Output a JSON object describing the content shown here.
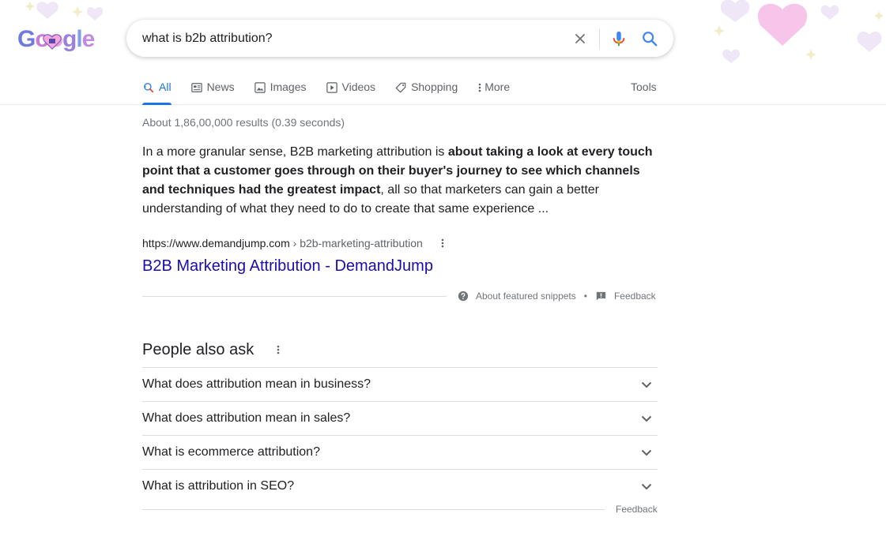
{
  "logo": {
    "text": "Google"
  },
  "search": {
    "query": "what is b2b attribution?"
  },
  "icons": {
    "clear": "close-icon",
    "voice": "microphone-icon",
    "search": "search-icon"
  },
  "tabs": [
    {
      "label": "All",
      "icon": "search-icon",
      "active": true
    },
    {
      "label": "News",
      "icon": "newspaper-icon"
    },
    {
      "label": "Images",
      "icon": "image-icon"
    },
    {
      "label": "Videos",
      "icon": "play-icon"
    },
    {
      "label": "Shopping",
      "icon": "tag-icon"
    },
    {
      "label": "More",
      "icon": "kebab-icon"
    }
  ],
  "tools_label": "Tools",
  "stats": "About 1,86,00,000 results (0.39 seconds)",
  "featured": {
    "text_pre": "In a more granular sense, B2B marketing attribution is ",
    "text_bold": "about taking a look at every touch point that a customer goes through on their buyer's journey to see which channels and techniques had the greatest impact",
    "text_post": ", all so that marketers can gain a better understanding of what they need to do to create that same experience ...",
    "cite_domain": "https://www.demandjump.com",
    "cite_path": " › b2b-marketing-attribution",
    "title": "B2B Marketing Attribution - DemandJump",
    "about_label": "About featured snippets",
    "separator": "•",
    "feedback_label": "Feedback"
  },
  "paa": {
    "title": "People also ask",
    "questions": [
      "What does attribution mean in business?",
      "What does attribution mean in sales?",
      "What is ecommerce attribution?",
      "What is attribution in SEO?"
    ],
    "feedback_label": "Feedback"
  },
  "colors": {
    "link": "#1a0dab",
    "accent": "#1a73e8",
    "heart": "#f5b8e6"
  }
}
